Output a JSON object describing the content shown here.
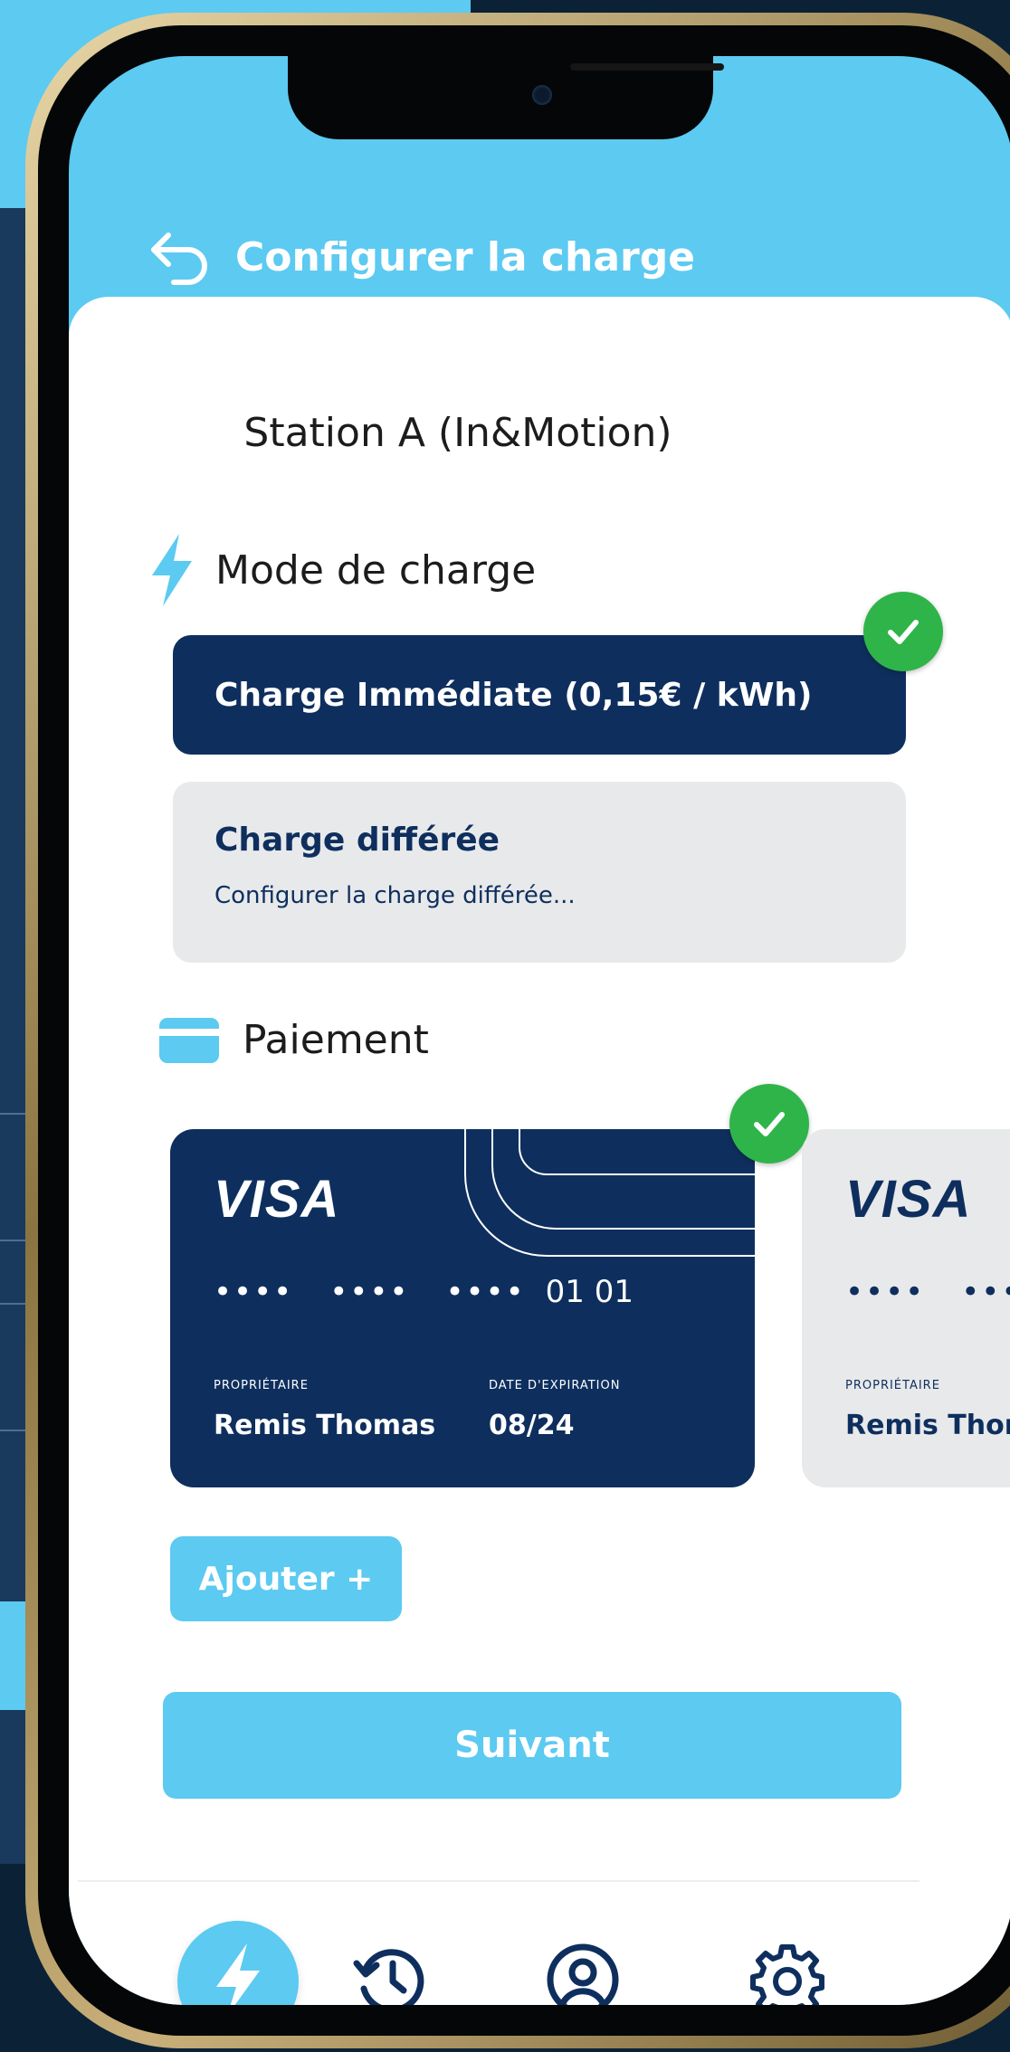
{
  "header": {
    "title": "Configurer la charge"
  },
  "station": {
    "name": "Station A (In&Motion)"
  },
  "mode": {
    "section_title": "Mode de charge",
    "immediate_label": "Charge Immédiate (0,15€ / kWh)",
    "deferred_title": "Charge différée",
    "deferred_subtitle": "Configurer la charge différée..."
  },
  "payment": {
    "section_title": "Paiement",
    "cards": [
      {
        "brand": "VISA",
        "masked": "••••",
        "last_digits": "01 01",
        "owner_label": "PROPRIÉTAIRE",
        "owner": "Remis Thomas",
        "expiry_label": "DATE D'EXPIRATION",
        "expiry": "08/24",
        "selected": true
      },
      {
        "brand": "VISA",
        "masked": "••••",
        "owner_label": "PROPRIÉTAIRE",
        "owner": "Remis Thom",
        "selected": false
      }
    ],
    "add_label": "Ajouter +"
  },
  "next_label": "Suivant",
  "nav": [
    "charge-icon",
    "history-icon",
    "account-icon",
    "settings-icon"
  ],
  "colors": {
    "primary": "#0e2f5e",
    "accent": "#5ccaf1",
    "success": "#2fb44a",
    "surface": "#e8e9ea"
  }
}
